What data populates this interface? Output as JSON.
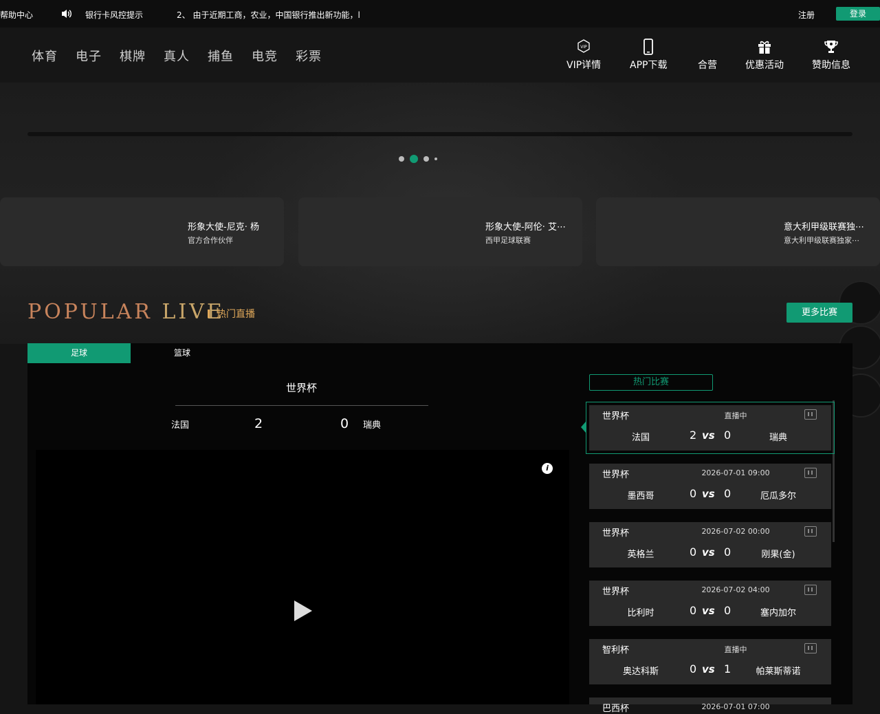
{
  "topbar": {
    "help": "帮助中心",
    "risk": "银行卡风控提示",
    "marquee": "2、 由于近期工商，农业，中国银行推出新功能，l",
    "register": "注册",
    "login": "登录"
  },
  "nav": {
    "items": [
      "体育",
      "电子",
      "棋牌",
      "真人",
      "捕鱼",
      "电竞",
      "彩票"
    ]
  },
  "tools": {
    "vip": "VIP详情",
    "app": "APP下载",
    "partner": "合营",
    "promo": "优惠活动",
    "sponsor": "赞助信息"
  },
  "cards": [
    {
      "title": "形象大使-尼克· 杨",
      "sub": "官方合作伙伴"
    },
    {
      "title": "形象大使-阿伦· 艾⋯",
      "sub": "西甲足球联赛"
    },
    {
      "title": "意大利甲级联赛独⋯",
      "sub": "意大利甲级联赛独家⋯"
    }
  ],
  "section": {
    "title1": "POPULAR",
    "title2": "LIVE",
    "sub": "热门直播",
    "more": "更多比赛"
  },
  "tabs": [
    "足球",
    "篮球"
  ],
  "current": {
    "league": "世界杯",
    "home": "法国",
    "home_score": "2",
    "away_score": "0",
    "away": "瑞典"
  },
  "hot_label": "热门比赛",
  "matches": [
    {
      "league": "世界杯",
      "status": "直播中",
      "home": "法国",
      "hs": "2",
      "as": "0",
      "away": "瑞典"
    },
    {
      "league": "世界杯",
      "status": "2026-07-01 09:00",
      "home": "墨西哥",
      "hs": "0",
      "as": "0",
      "away": "厄瓜多尔"
    },
    {
      "league": "世界杯",
      "status": "2026-07-02 00:00",
      "home": "英格兰",
      "hs": "0",
      "as": "0",
      "away": "刚果(金)"
    },
    {
      "league": "世界杯",
      "status": "2026-07-02 04:00",
      "home": "比利时",
      "hs": "0",
      "as": "0",
      "away": "塞内加尔"
    },
    {
      "league": "智利杯",
      "status": "直播中",
      "home": "奥达科斯",
      "hs": "0",
      "as": "1",
      "away": "帕莱斯蒂诺"
    },
    {
      "league": "巴西杯",
      "status": "2026-07-01 07:00",
      "home": "",
      "hs": "",
      "as": "",
      "away": ""
    }
  ],
  "vs": "vs",
  "info": "i"
}
